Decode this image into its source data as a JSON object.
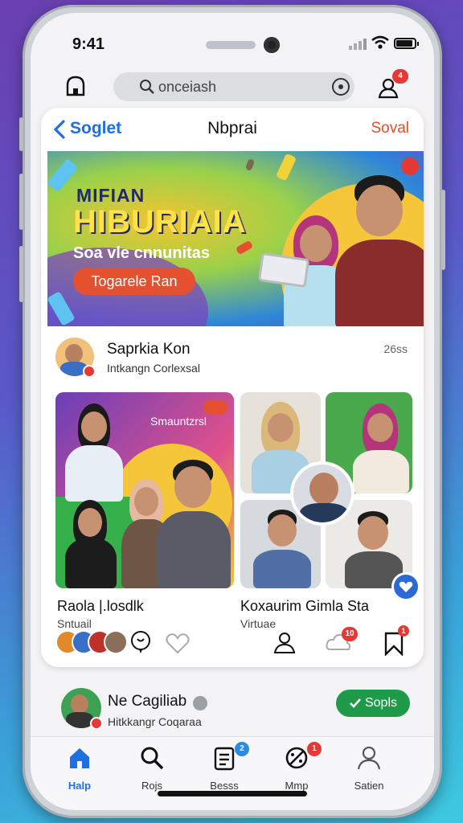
{
  "status": {
    "time": "9:41"
  },
  "topbar": {
    "search_value": "onceiash",
    "notif_badge": "4"
  },
  "nav": {
    "back_label": "Soglet",
    "title": "Nbprai",
    "action_label": "Soval"
  },
  "banner": {
    "title_line1": "MIFIAN",
    "title_line2": "HIBURIAIA",
    "subtitle": "Soa vle cnnunitas",
    "button_label": "Togarele Ran"
  },
  "post": {
    "author": "Saprkia Kon",
    "subtitle": "Intkangn Corlexsal",
    "time": "26ss",
    "left_card": {
      "chip": "Smauntzrsl",
      "title": "Raola |.losdlk",
      "sub": "Sntuail"
    },
    "right_card": {
      "title": "Koxaurim Gimla Sta",
      "sub": "Virtuae"
    },
    "comment_badge": "10",
    "bookmark_badge": "1"
  },
  "post2": {
    "author": "Ne Cagiliab",
    "subtitle": "Hitkkangr Coqaraa",
    "follow_label": "Sopls"
  },
  "tabs": [
    {
      "label": "Halp",
      "icon": "home-icon",
      "active": true
    },
    {
      "label": "Rojs",
      "icon": "search-icon",
      "active": false
    },
    {
      "label": "Besss",
      "icon": "list-icon",
      "active": false,
      "badge": "2"
    },
    {
      "label": "Mmp",
      "icon": "slash-icon",
      "active": false,
      "badge": "1"
    },
    {
      "label": "Satien",
      "icon": "profile-icon",
      "active": false
    }
  ],
  "colors": {
    "accent": "#1e6fe0",
    "action": "#e0502a",
    "follow": "#1e9a4a",
    "badge": "#e53935"
  }
}
